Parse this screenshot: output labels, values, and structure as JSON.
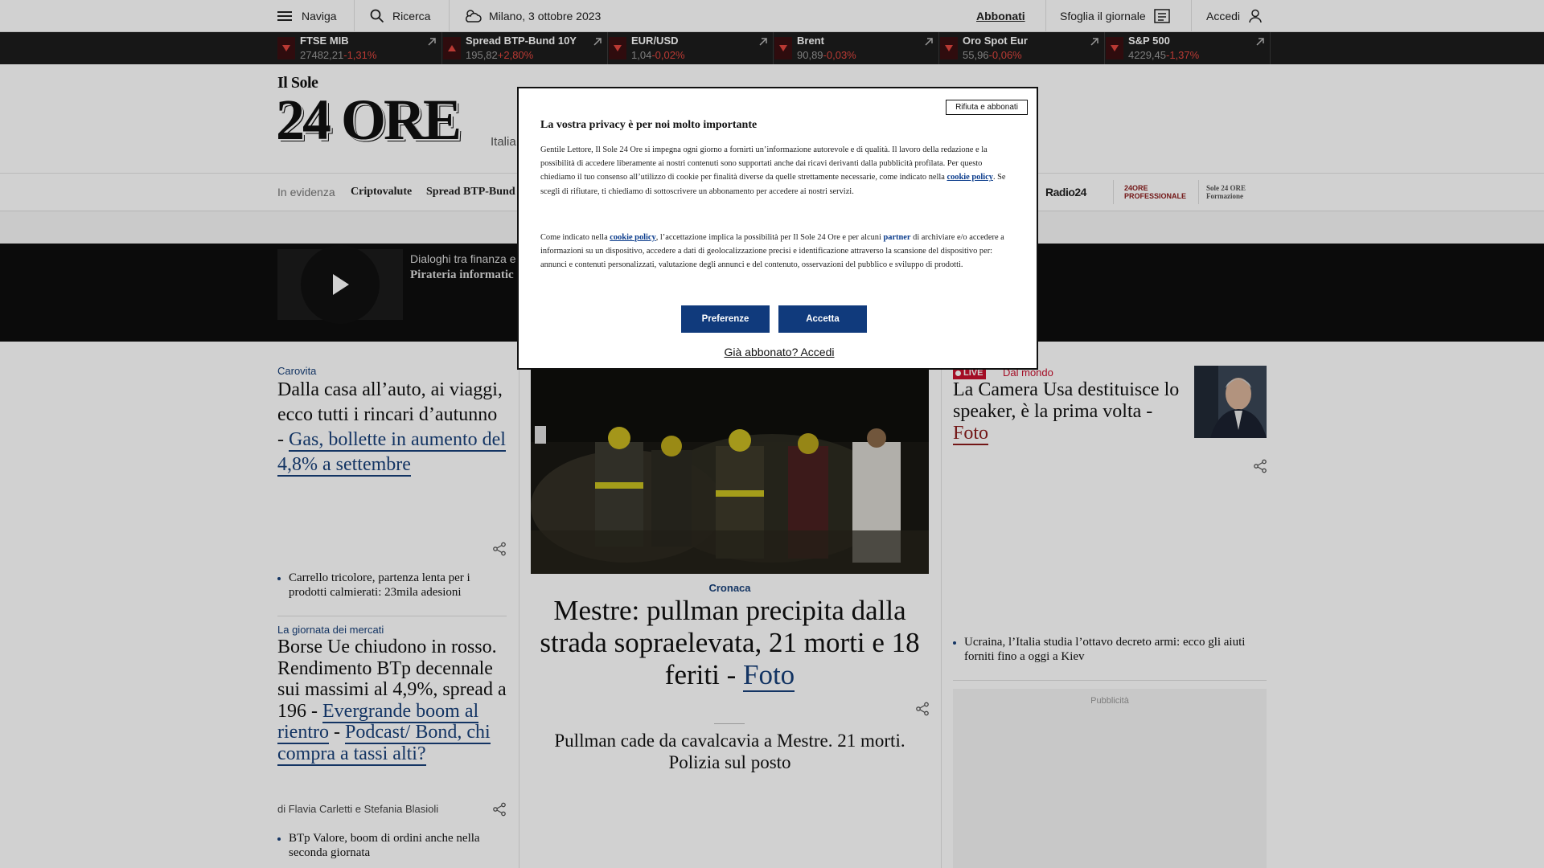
{
  "topbar": {
    "menu_label": "Naviga",
    "search_label": "Ricerca",
    "weather_date": "Milano, 3 ottobre 2023",
    "subscribe_label": "Abbonati",
    "newspaper_label": "Sfoglia il giornale",
    "login_label": "Accedi"
  },
  "ticker": [
    {
      "name": "FTSE MIB",
      "value": "27482,21",
      "change": "-1,31%",
      "direction": "down"
    },
    {
      "name": "Spread BTP-Bund 10Y",
      "value": "195,82",
      "change": "+2,80%",
      "direction": "up"
    },
    {
      "name": "EUR/USD",
      "value": "1,04",
      "change": "-0,02%",
      "direction": "down"
    },
    {
      "name": "Brent",
      "value": "90,89",
      "change": "-0,03%",
      "direction": "down"
    },
    {
      "name": "Oro Spot Eur",
      "value": "55,96",
      "change": "-0,06%",
      "direction": "down"
    },
    {
      "name": "S&P 500",
      "value": "4229,45",
      "change": "-1,37%",
      "direction": "down"
    }
  ],
  "masthead": {
    "logo_top": "Il Sole",
    "logo_main": "24 ORE",
    "subtitle": "Italia"
  },
  "nav": {
    "label": "In evidenza",
    "items": [
      "Criptovalute",
      "Spread BTP-Bund"
    ],
    "brands": [
      "Radio24",
      "24ORE PROFESSIONALE",
      "Sole 24 ORE Formazione"
    ]
  },
  "podcast": {
    "line1": "Dialoghi tra finanza e",
    "line2": "Pirateria informatic"
  },
  "left_col": {
    "story1": {
      "kicker": "Carovita",
      "headline": "Dalla casa all’auto, ai viaggi, ecco tutti i rincari d’autunno - ",
      "link": "Gas, bollette in aumento del 4,8% a settembre"
    },
    "bullet1": "Carrello tricolore, partenza lenta per i prodotti calmierati: 23mila adesioni",
    "story2": {
      "kicker": "La giornata dei mercati",
      "headline": "Borse Ue chiudono in rosso. Rendimento BTp decennale sui massimi al 4,9%, spread a 196 - ",
      "link1": "Evergrande boom al rientro",
      "sep": " - ",
      "link2": "Podcast/ Bond, chi compra a tassi alti?",
      "byline": "di Flavia Carletti e Stefania Blasioli"
    },
    "bullet2": "BTp Valore, boom di ordini anche nella seconda giornata"
  },
  "center_col": {
    "kicker": "Cronaca",
    "headline": "Mestre: pullman precipita dalla strada sopraelevata, 21 morti e 18 feriti - ",
    "link": "Foto",
    "subhead": "Pullman cade da cavalcavia a Mestre. 21 morti. Polizia sul posto"
  },
  "right_col": {
    "live_badge": "LIVE",
    "kicker": "Dal mondo",
    "headline": "La Camera Usa destituisce lo speaker, è la prima volta - ",
    "link": "Foto",
    "bullet": "Ucraina, l’Italia studia l’ottavo decreto armi: ecco gli aiuti forniti fino a oggi a Kiev",
    "ad_label": "Pubblicità"
  },
  "modal": {
    "reject_label": "Rifiuta e abbonati",
    "title": "La vostra privacy è per noi molto importante",
    "p1_a": "Gentile Lettore, Il Sole 24 Ore si impegna ogni giorno a fornirti un’informazione autorevole e di qualità. Il lavoro della redazione e la possibilità di accedere liberamente ai nostri contenuti sono supportati anche dai ricavi derivanti dalla pubblicità profilata. Per questo chiediamo il tuo consenso all’utilizzo di cookie per finalità diverse da quelle strettamente necessarie, come indicato nella ",
    "p1_link": "cookie policy",
    "p1_b": ". Se scegli di rifiutare, ti chiediamo di sottoscrivere un abbonamento per accedere ai nostri servizi.",
    "p2_a": "Come indicato nella ",
    "p2_link": "cookie policy",
    "p2_b": ", l’accettazione implica la possibilità per Il Sole 24 Ore e per alcuni ",
    "p2_partner": "partner",
    "p2_c": " di archiviare e/o accedere a informazioni su un dispositivo, accedere a dati di geolocalizzazione precisi e identificazione attraverso la scansione del dispositivo per: annunci e contenuti personalizzati, valutazione degli annunci e del contenuto, osservazioni del pubblico e sviluppo di prodotti.",
    "prefs_label": "Preferenze",
    "accept_label": "Accetta",
    "already_label": "Già abbonato? Accedi"
  }
}
